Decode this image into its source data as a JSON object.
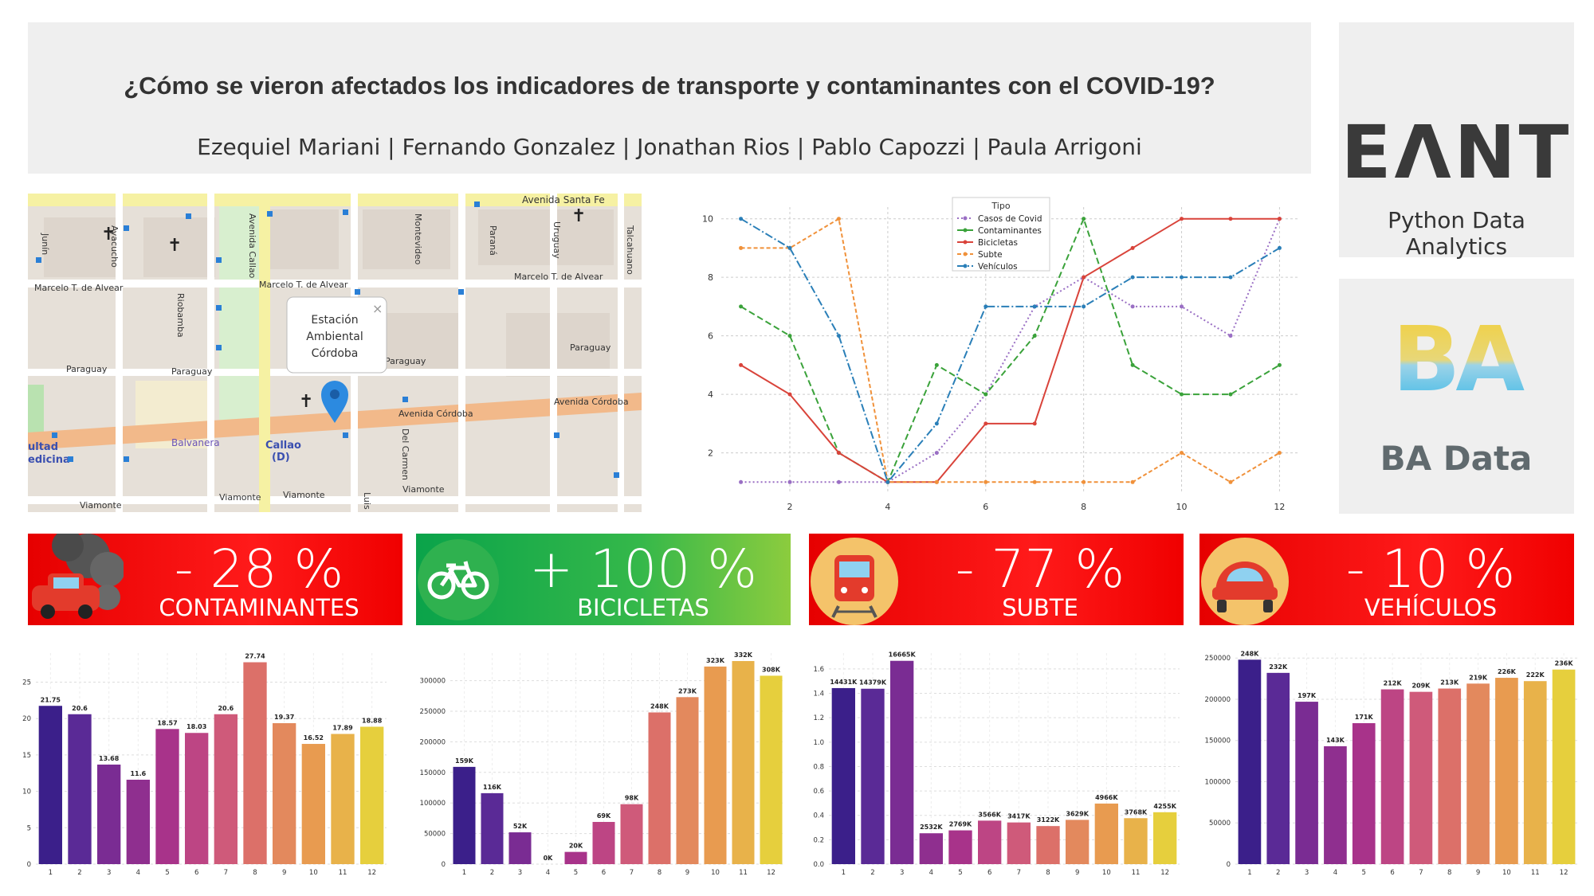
{
  "header": {
    "title": "¿Cómo se vieron afectados los indicadores de transporte y contaminantes con el COVID-19?",
    "authors": "Ezequiel Mariani | Fernando Gonzalez | Jonathan Rios | Pablo Capozzi | Paula Arrigoni"
  },
  "logos": {
    "eant": "EΛNT",
    "eant_sub": "Python Data Analytics",
    "ba": "BA",
    "ba_sub": "BA Data"
  },
  "map": {
    "popup": [
      "Estación",
      "Ambiental",
      "Córdoba"
    ],
    "popup_close": "×",
    "streets": {
      "santa_fe": "Avenida Santa Fe",
      "alvear1": "Marcelo T. de Alvear",
      "alvear2": "Marcelo T. de Alvear",
      "alvear3": "Marcelo T. de Alvear",
      "paraguay1": "Paraguay",
      "paraguay2": "Paraguay",
      "paraguay3": "Paraguay",
      "paraguay4": "Paraguay",
      "cordoba1": "Avenida Córdoba",
      "cordoba2": "Avenida Córdoba",
      "viamonte1": "Viamonte",
      "viamonte2": "Viamonte",
      "viamonte3": "Viamonte",
      "viamonte4": "Viamonte",
      "callao_av": "Avenida Callao",
      "junin": "Junín",
      "ayacucho": "Ayacucho",
      "riobamba": "Riobamba",
      "montevideo": "Montevideo",
      "parana": "Paraná",
      "uruguay": "Uruguay",
      "talcahuano": "Talcahuano",
      "del_carmen": "Del Carmen",
      "luis": "Luis",
      "balvanera": "Balvanera",
      "callao": "Callao",
      "callao_d": "(D)",
      "facultad1": "ultad",
      "facultad2": "edicina"
    }
  },
  "banners": [
    {
      "pct": "- 28 %",
      "label": "CONTAMINANTES"
    },
    {
      "pct": "+ 100 %",
      "label": "BICICLETAS"
    },
    {
      "pct": "- 77 %",
      "label": "SUBTE"
    },
    {
      "pct": "- 10 %",
      "label": "VEHÍCULOS"
    }
  ],
  "chart_data": [
    {
      "type": "line",
      "legend_title": "Tipo",
      "legend_placement": "top-center",
      "x": [
        1,
        2,
        3,
        4,
        5,
        6,
        7,
        8,
        9,
        10,
        11,
        12
      ],
      "xticks": [
        2,
        4,
        6,
        8,
        10,
        12
      ],
      "yticks": [
        2,
        4,
        6,
        8,
        10
      ],
      "ylim": [
        1,
        10
      ],
      "grid": true,
      "series": [
        {
          "name": "Casos de Covid",
          "color": "#9a6fc4",
          "dash": "2,3",
          "values": [
            1,
            1,
            1,
            1,
            2,
            4,
            7,
            8,
            7,
            7,
            6,
            10
          ]
        },
        {
          "name": "Contaminantes",
          "color": "#3aa23a",
          "dash": "8,4",
          "values": [
            7,
            6,
            2,
            1,
            5,
            4,
            6,
            10,
            5,
            4,
            4,
            5
          ]
        },
        {
          "name": "Bicicletas",
          "color": "#d9433a",
          "dash": "",
          "values": [
            5,
            4,
            2,
            1,
            1,
            3,
            3,
            8,
            9,
            10,
            10,
            10
          ]
        },
        {
          "name": "Subte",
          "color": "#f0913a",
          "dash": "5,3",
          "values": [
            9,
            9,
            10,
            1,
            1,
            1,
            1,
            1,
            1,
            2,
            1,
            2
          ]
        },
        {
          "name": "Vehículos",
          "color": "#2a7fb8",
          "dash": "10,3,2,3",
          "values": [
            10,
            9,
            6,
            1,
            3,
            7,
            7,
            7,
            8,
            8,
            8,
            9
          ]
        }
      ]
    },
    {
      "type": "bar",
      "categories": [
        "1",
        "2",
        "3",
        "4",
        "5",
        "6",
        "7",
        "8",
        "9",
        "10",
        "11",
        "12"
      ],
      "values": [
        21.75,
        20.6,
        13.68,
        11.6,
        18.57,
        18.03,
        20.6,
        27.74,
        19.37,
        16.52,
        17.89,
        18.88
      ],
      "data_labels": [
        "21.75",
        "20.6",
        "13.68",
        "11.6",
        "18.57",
        "18.03",
        "20.6",
        "27.74",
        "19.37",
        "16.52",
        "17.89",
        "18.88"
      ],
      "yticks": [
        "0",
        "5",
        "10",
        "15",
        "20",
        "25"
      ],
      "ytick_values": [
        0,
        5,
        10,
        15,
        20,
        25
      ],
      "ylim": [
        0,
        29
      ]
    },
    {
      "type": "bar",
      "categories": [
        "1",
        "2",
        "3",
        "4",
        "5",
        "6",
        "7",
        "8",
        "9",
        "10",
        "11",
        "12"
      ],
      "values": [
        159000,
        116000,
        52000,
        0,
        20000,
        69000,
        98000,
        248000,
        273000,
        323000,
        332000,
        308000
      ],
      "data_labels": [
        "159K",
        "116K",
        "52K",
        "0K",
        "20K",
        "69K",
        "98K",
        "248K",
        "273K",
        "323K",
        "332K",
        "308K"
      ],
      "yticks": [
        "0",
        "50000",
        "100000",
        "150000",
        "200000",
        "250000",
        "300000"
      ],
      "ytick_values": [
        0,
        50000,
        100000,
        150000,
        200000,
        250000,
        300000
      ],
      "ylim": [
        0,
        345000
      ]
    },
    {
      "type": "bar",
      "categories": [
        "1",
        "2",
        "3",
        "4",
        "5",
        "6",
        "7",
        "8",
        "9",
        "10",
        "11",
        "12"
      ],
      "values": [
        1.4431,
        1.4379,
        1.6665,
        0.2532,
        0.2769,
        0.3566,
        0.3417,
        0.3122,
        0.3629,
        0.4966,
        0.3768,
        0.4255
      ],
      "data_labels": [
        "14431K",
        "14379K",
        "16665K",
        "2532K",
        "2769K",
        "3566K",
        "3417K",
        "3122K",
        "3629K",
        "4966K",
        "3768K",
        "4255K"
      ],
      "yticks": [
        "0.0",
        "0.2",
        "0.4",
        "0.6",
        "0.8",
        "1.0",
        "1.2",
        "1.4",
        "1.6"
      ],
      "ytick_values": [
        0,
        0.2,
        0.4,
        0.6,
        0.8,
        1.0,
        1.2,
        1.4,
        1.6
      ],
      "ylim": [
        0,
        1.73
      ]
    },
    {
      "type": "bar",
      "categories": [
        "1",
        "2",
        "3",
        "4",
        "5",
        "6",
        "7",
        "8",
        "9",
        "10",
        "11",
        "12"
      ],
      "values": [
        248000,
        232000,
        197000,
        143000,
        171000,
        212000,
        209000,
        213000,
        219000,
        226000,
        222000,
        236000
      ],
      "data_labels": [
        "248K",
        "232K",
        "197K",
        "143K",
        "171K",
        "212K",
        "209K",
        "213K",
        "219K",
        "226K",
        "222K",
        "236K"
      ],
      "yticks": [
        "0",
        "50000",
        "100000",
        "150000",
        "200000",
        "250000"
      ],
      "ytick_values": [
        0,
        50000,
        100000,
        150000,
        200000,
        250000
      ],
      "ylim": [
        0,
        256000
      ]
    }
  ]
}
